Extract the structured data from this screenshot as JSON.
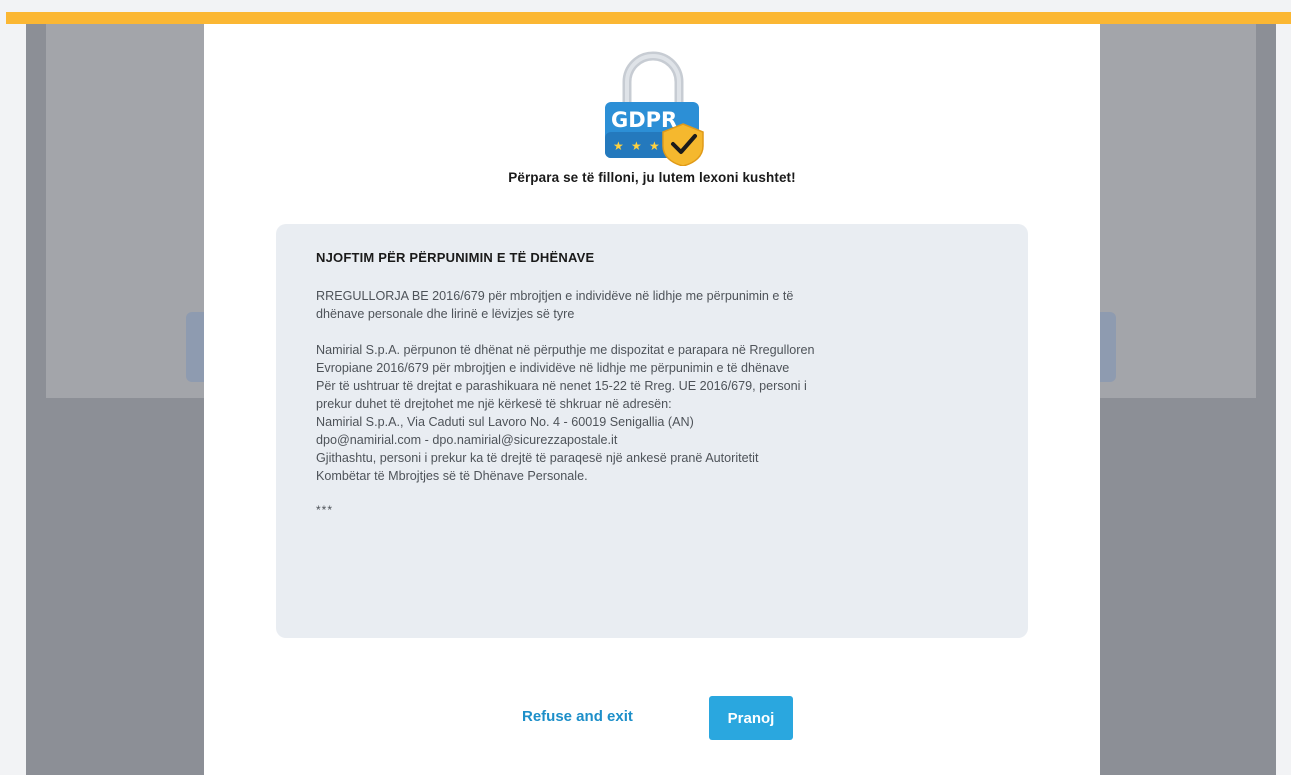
{
  "colors": {
    "accent_bar": "#fbb733",
    "primary_button": "#2aa7df",
    "link_text": "#1d8fc9",
    "notice_background": "#e9edf2",
    "overlay": "#8c8f96"
  },
  "logo": {
    "icon": "gdpr-lock-shield-icon",
    "text": "GDPR"
  },
  "modal": {
    "intro_title": "Përpara se të filloni, ju lutem lexoni kushtet!",
    "notice": {
      "heading": "NJOFTIM PËR PËRPUNIMIN E TË DHËNAVE",
      "intro": "RREGULLORJA BE 2016/679 për mbrojtjen e individëve në lidhje me përpunimin e të\ndhënave personale dhe lirinë e lëvizjes së tyre",
      "body": "Namirial S.p.A. përpunon të dhënat në përputhje me dispozitat e parapara në Rregulloren\nEvropiane 2016/679 për mbrojtjen e individëve në lidhje me përpunimin e të dhënave\nPër të ushtruar të drejtat e parashikuara në nenet 15-22 të Rreg. UE 2016/679, personi i\nprekur duhet të drejtohet me një kërkesë të shkruar në adresën:\nNamirial S.p.A., Via Caduti sul Lavoro No. 4 - 60019 Senigallia (AN)\ndpo@namirial.com - dpo.namirial@sicurezzapostale.it\nGjithashtu, personi i prekur ka të drejtë të paraqesë një ankesë pranë Autoritetit\nKombëtar të Mbrojtjes së të Dhënave Personale.",
      "ellipsis": "***"
    },
    "actions": {
      "refuse_label": "Refuse and exit",
      "accept_label": "Pranoj"
    }
  }
}
